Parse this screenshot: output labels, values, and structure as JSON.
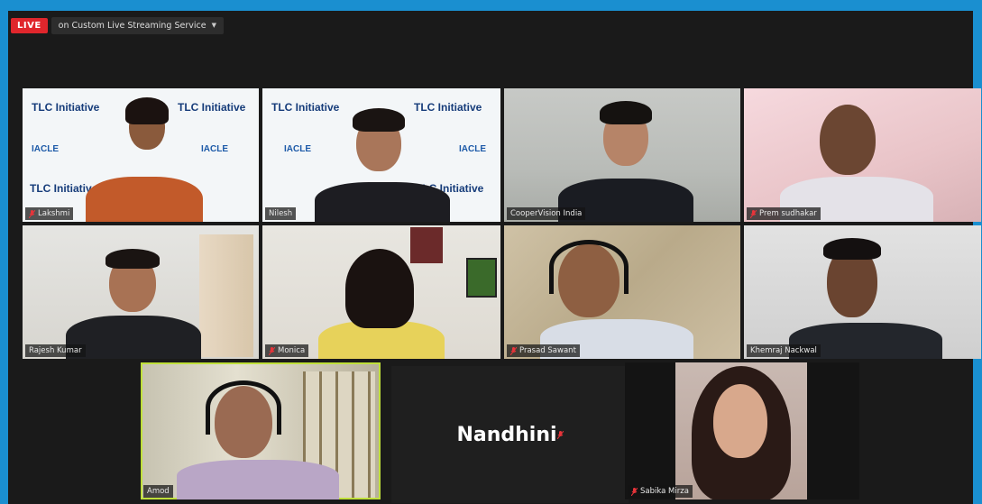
{
  "header": {
    "live_label": "LIVE",
    "stream_label": "on Custom Live Streaming Service",
    "caret": "▼"
  },
  "participants": [
    {
      "name": "Lakshmi",
      "muted": true
    },
    {
      "name": "Nilesh",
      "muted": false
    },
    {
      "name": "CooperVision India",
      "muted": false
    },
    {
      "name": "Prem sudhakar",
      "muted": true
    },
    {
      "name": "Rajesh Kumar",
      "muted": false
    },
    {
      "name": "Monica",
      "muted": true
    },
    {
      "name": "Prasad Sawant",
      "muted": true
    },
    {
      "name": "Khemraj Nackwal",
      "muted": false
    },
    {
      "name": "Amod",
      "muted": false,
      "active_speaker": true
    },
    {
      "name": "Nandhini",
      "muted": true,
      "video_off": true
    },
    {
      "name": "Sabika Mirza",
      "muted": true
    }
  ],
  "banner_text": {
    "logo": "TLC Initiative",
    "iacle": "IACLE"
  },
  "colors": {
    "frame_border": "#1a8fd0",
    "live_badge": "#e0262c",
    "active_speaker_border": "#bfe03a",
    "mic_muted": "#e8343a"
  },
  "icons": {
    "mic_muted": "mic-muted-icon",
    "dropdown": "chevron-down-icon"
  }
}
